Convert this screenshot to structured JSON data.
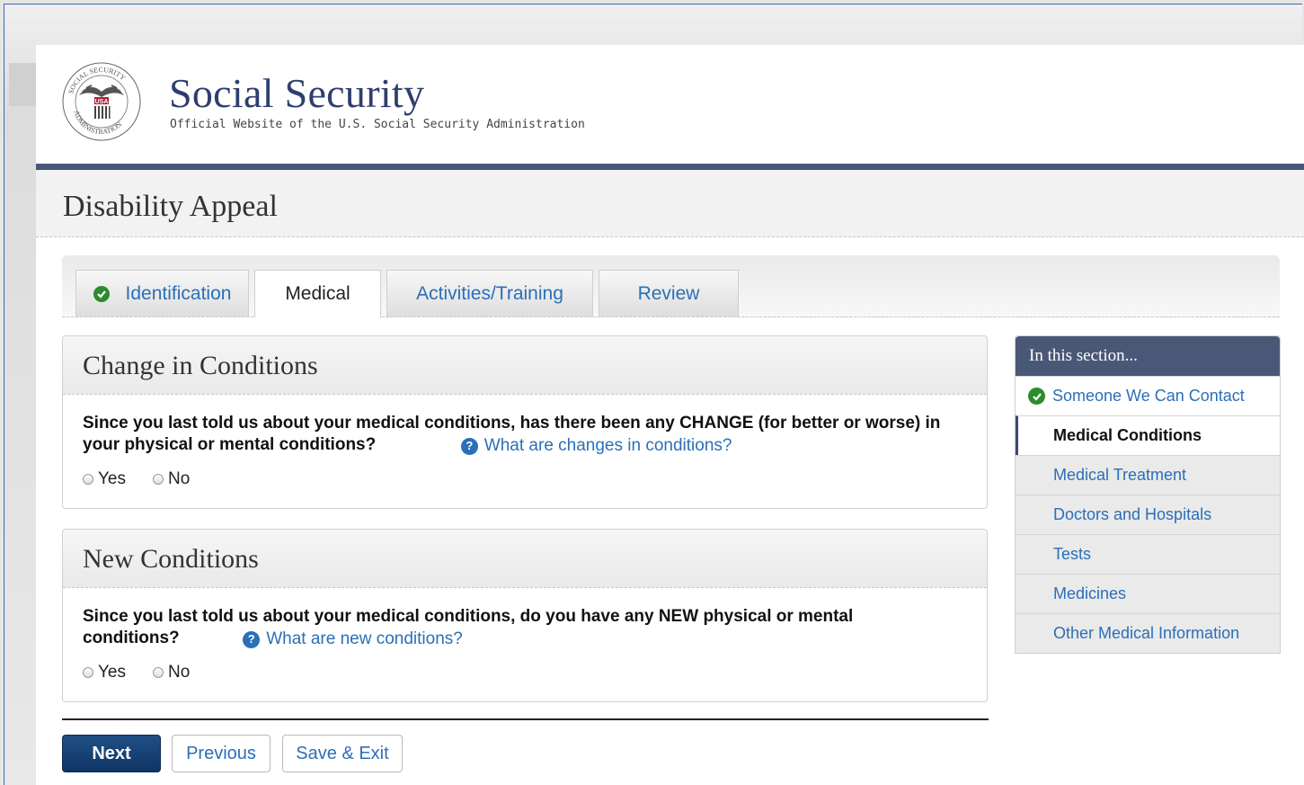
{
  "header": {
    "title": "Social Security",
    "subtitle": "Official Website of the U.S. Social Security Administration",
    "seal_text": "SOCIAL SECURITY ADMINISTRATION USA"
  },
  "page_title": "Disability Appeal",
  "tabs": [
    {
      "label": "Identification",
      "completed": true,
      "active": false
    },
    {
      "label": "Medical",
      "completed": false,
      "active": true
    },
    {
      "label": "Activities/Training",
      "completed": false,
      "active": false
    },
    {
      "label": "Review",
      "completed": false,
      "active": false
    }
  ],
  "sections": [
    {
      "title": "Change in Conditions",
      "question": "Since you last told us about your medical conditions, has there been any CHANGE (for better or worse) in your physical or mental conditions?",
      "help_link": "What are changes in conditions?",
      "options": [
        "Yes",
        "No"
      ]
    },
    {
      "title": "New Conditions",
      "question": "Since you last told us about your medical conditions, do you have any NEW physical or mental conditions?",
      "help_link": "What are new conditions?",
      "options": [
        "Yes",
        "No"
      ]
    }
  ],
  "buttons": {
    "next": "Next",
    "previous": "Previous",
    "save_exit": "Save & Exit"
  },
  "sidenav": {
    "heading": "In this section...",
    "items": [
      {
        "label": "Someone We Can Contact",
        "state": "completed"
      },
      {
        "label": "Medical Conditions",
        "state": "current"
      },
      {
        "label": "Medical Treatment",
        "state": "pending"
      },
      {
        "label": "Doctors and Hospitals",
        "state": "pending"
      },
      {
        "label": "Tests",
        "state": "pending"
      },
      {
        "label": "Medicines",
        "state": "pending"
      },
      {
        "label": "Other Medical Information",
        "state": "pending"
      }
    ]
  },
  "colors": {
    "navy": "#4a5878",
    "link": "#2a6fb8",
    "check_green": "#2e8b2e",
    "primary_button": "#1f4f85"
  }
}
